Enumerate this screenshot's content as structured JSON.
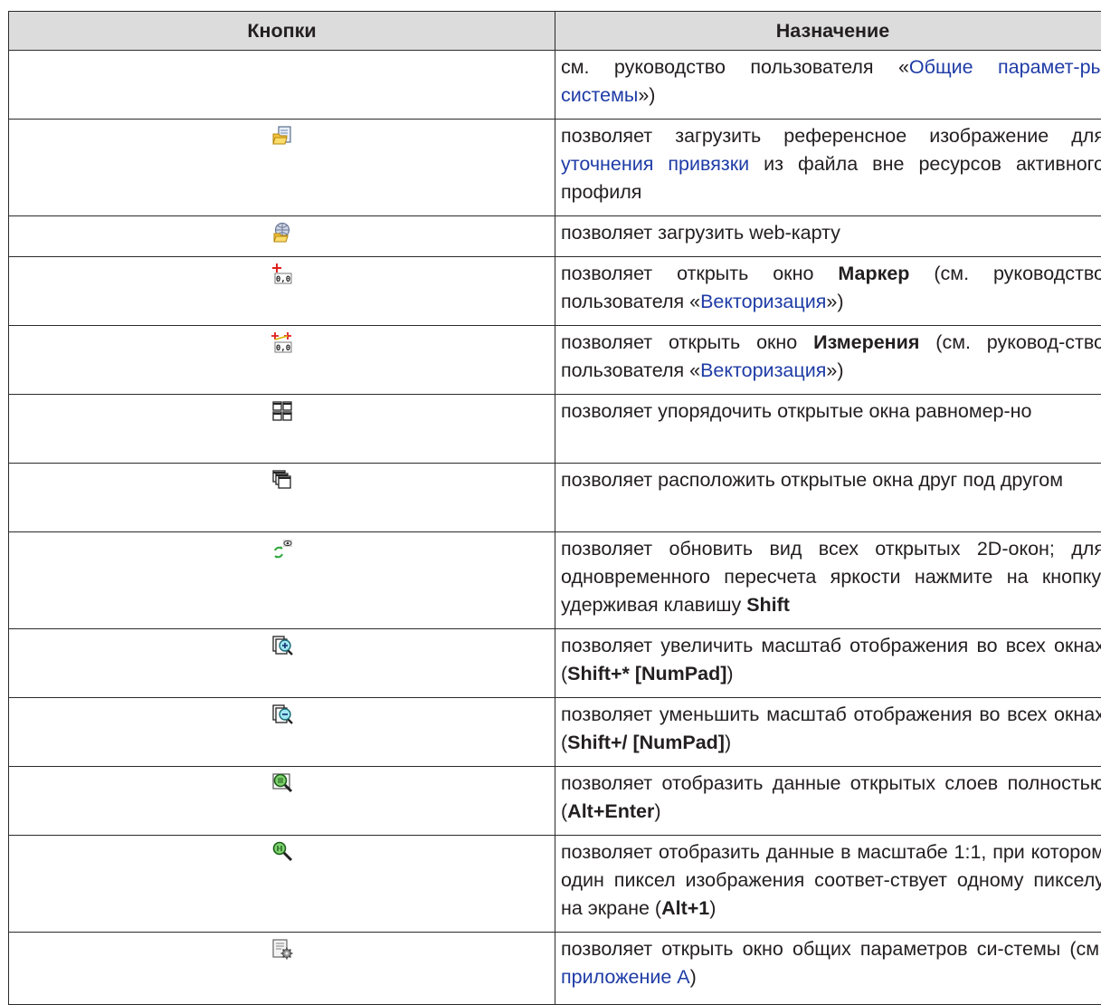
{
  "header": {
    "col_buttons": "Кнопки",
    "col_purpose": "Назначение"
  },
  "rows": [
    {
      "icon": "none",
      "desc": {
        "t1": "см. руководство пользователя «",
        "link": "Общие парамет-ры системы",
        "t2": "»)"
      }
    },
    {
      "icon": "load-reference-image-icon",
      "desc": {
        "t1": "позволяет загрузить референсное изображение для ",
        "link": "уточнения привязки",
        "t2": " из файла вне ресурсов активного профиля"
      }
    },
    {
      "icon": "load-web-map-icon",
      "desc": {
        "t1": "позволяет загрузить web-карту"
      }
    },
    {
      "icon": "marker-window-icon",
      "desc": {
        "t1": "позволяет открыть окно ",
        "bold": "Маркер",
        "t2": " (см. руководство пользователя «",
        "link": "Векторизация",
        "t3": "»)"
      }
    },
    {
      "icon": "measurements-window-icon",
      "desc": {
        "t1": "позволяет открыть окно ",
        "bold": "Измерения",
        "t2": " (см. руковод-ство пользователя «",
        "link": "Векторизация",
        "t3": "»)"
      }
    },
    {
      "icon": "tile-windows-icon",
      "desc": {
        "t1": "позволяет упорядочить открытые окна равномер-но"
      }
    },
    {
      "icon": "cascade-windows-icon",
      "desc": {
        "t1": "позволяет расположить открытые окна друг под другом"
      }
    },
    {
      "icon": "refresh-2d-windows-icon",
      "desc": {
        "t1": "позволяет обновить вид всех открытых 2D-окон; для одновременного пересчета яркости нажмите на кнопку, удерживая клавишу ",
        "bold": "Shift"
      }
    },
    {
      "icon": "zoom-in-all-windows-icon",
      "desc": {
        "t1": "позволяет увеличить масштаб отображения во всех окнах (",
        "bold": "Shift+* [NumPad]",
        "t2": ")"
      }
    },
    {
      "icon": "zoom-out-all-windows-icon",
      "desc": {
        "t1": "позволяет уменьшить масштаб отображения во всех окнах (",
        "bold": "Shift+/ [NumPad]",
        "t2": ")"
      }
    },
    {
      "icon": "zoom-to-extent-icon",
      "desc": {
        "t1": "позволяет отобразить данные открытых слоев полностью (",
        "bold": "Alt+Enter",
        "t2": ")"
      }
    },
    {
      "icon": "zoom-1-to-1-icon",
      "desc": {
        "t1": "позволяет отобразить данные в масштабе 1:1, при котором один пиксел изображения соответ-ствует одному пикселу на экране (",
        "bold": "Alt+1",
        "t2": ")"
      }
    },
    {
      "icon": "system-settings-icon",
      "desc": {
        "t1": "позволяет открыть окно общих параметров си-стемы (см. ",
        "link": "приложение А",
        "t2": ")"
      }
    }
  ]
}
